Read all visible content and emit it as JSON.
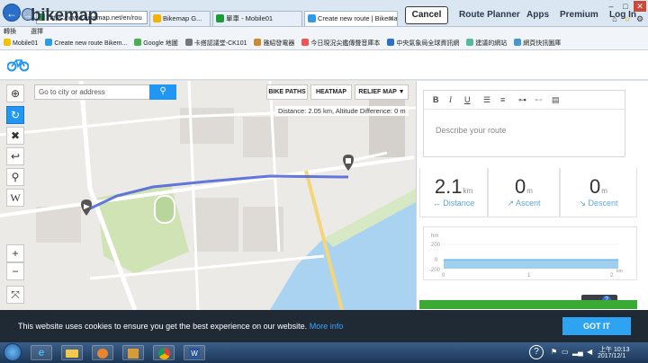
{
  "browser": {
    "url": "https://www.bikemap.net/en/rou",
    "tabs": [
      {
        "title": "Bikemap G..."
      },
      {
        "title": "單車 - Mobile01"
      },
      {
        "title": "Create new route | Bikema..."
      }
    ],
    "menu": [
      "轉換",
      "選擇"
    ],
    "favorites": [
      "Mobile01",
      "Create new route  Bikem...",
      "Google 地圖",
      "卡搭認議堂-CK101",
      "雅紹發電器",
      "今日現況尖鑑傳聲音庫本",
      "中央氣象局全球資訊網",
      "建議的網站",
      "網頁快訊圖庫"
    ]
  },
  "site": {
    "logo": "bikemap",
    "cancel_label": "Cancel",
    "nav": [
      "Route Planner",
      "Apps",
      "Premium",
      "Log In"
    ]
  },
  "map": {
    "search_placeholder": "Go to city or address",
    "buttons": [
      "BIKE PATHS",
      "HEATMAP",
      "RELIEF MAP ▼"
    ],
    "info": "Distance: 2.05 km, Altitude Difference: 0 m",
    "zoom_in": "+",
    "zoom_out": "−"
  },
  "panel": {
    "description_placeholder": "Describe your route",
    "stats": [
      {
        "value": "2.1",
        "unit": "km",
        "label": "Distance"
      },
      {
        "value": "0",
        "unit": "m",
        "label": "Ascent"
      },
      {
        "value": "0",
        "unit": "m",
        "label": "Descent"
      }
    ],
    "elevation": {
      "y_unit": "hm",
      "y_ticks": [
        "200",
        "0",
        "-200"
      ],
      "x_ticks": [
        "0",
        "1",
        "2"
      ],
      "x_unit": "km"
    }
  },
  "cookie": {
    "text": "This website uses cookies to ensure you get the best experience on our website.",
    "link": "More info",
    "button": "GOT IT"
  },
  "taskbar": {
    "time": "上午 10:13",
    "date": "2017/12/1"
  }
}
